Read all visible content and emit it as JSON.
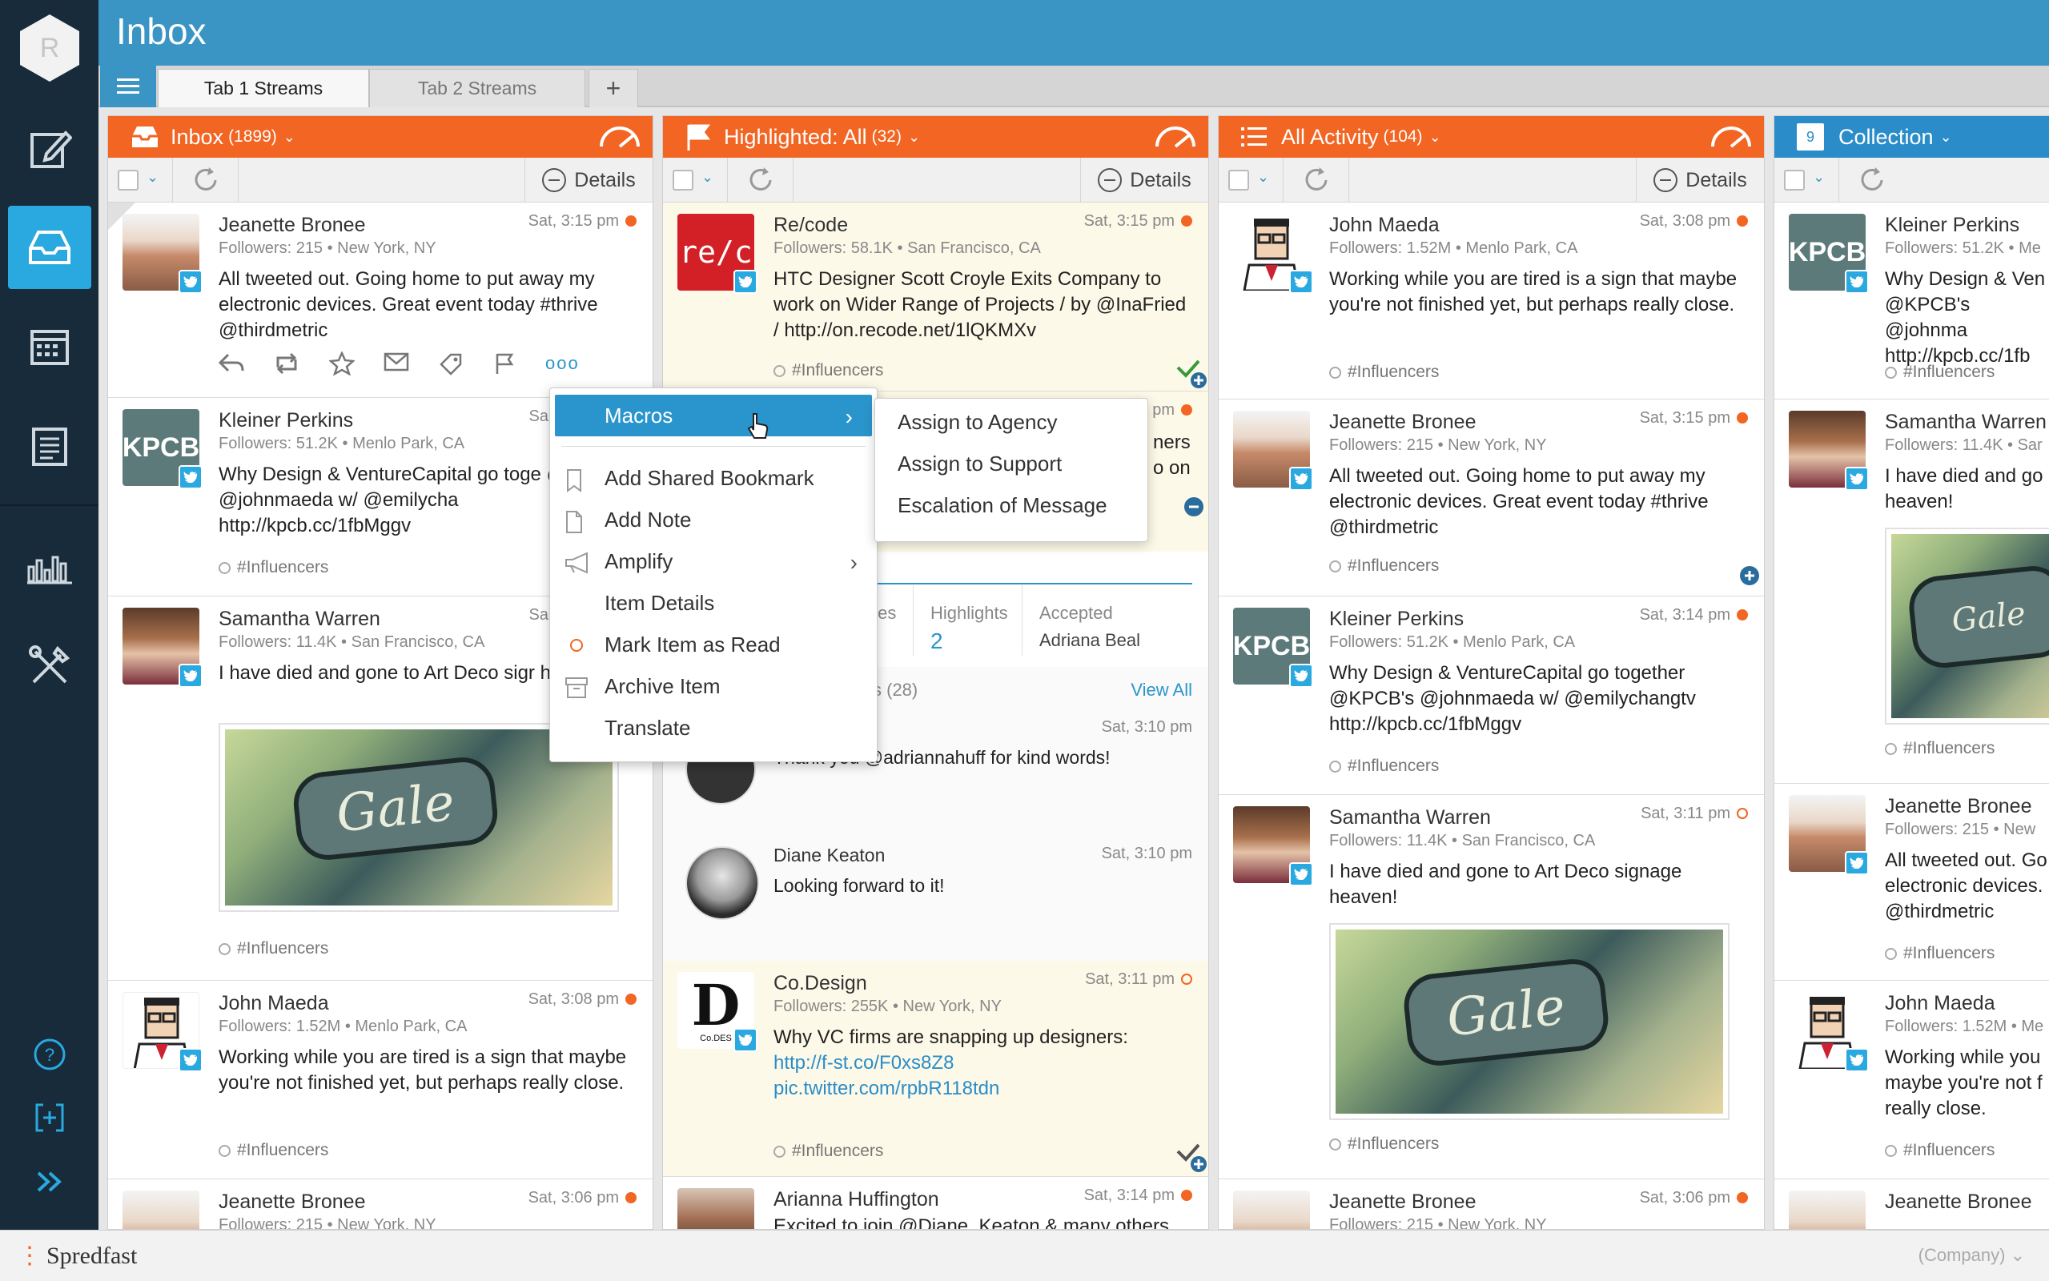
{
  "app": {
    "title": "Inbox",
    "brand_letter": "R",
    "footer_logo": "Spredfast",
    "footer_company": "(Company)"
  },
  "tabs": [
    {
      "label": "Tab 1 Streams",
      "active": true
    },
    {
      "label": "Tab 2 Streams",
      "active": false
    }
  ],
  "colors": {
    "orange": "#f26522",
    "blue": "#2a95cc",
    "nav": "#172b3a",
    "topbar": "#3a95c4"
  },
  "toolbar_details": "Details",
  "columns": [
    {
      "title": "Inbox",
      "count": "(1899)",
      "icon": "inbox-tray-icon"
    },
    {
      "title": "Highlighted: All",
      "count": "(32)",
      "icon": "flag-icon"
    },
    {
      "title": "All Activity",
      "count": "(104)",
      "icon": "list-icon"
    },
    {
      "title": "Collection",
      "count": "",
      "icon": "calendar-9-icon",
      "badge": "9"
    }
  ],
  "col1": [
    {
      "name": "Jeanette Bronee",
      "meta": "Followers: 215 • New York, NY",
      "time": "Sat, 3:15 pm",
      "text": "All tweeted out. Going home to put away my electronic devices. Great event today #thrive @thirdmetric"
    },
    {
      "name": "Kleiner Perkins",
      "meta": "Followers: 51.2K • Menlo Park, CA",
      "time": "Sa",
      "text": "Why Design & VentureCapital go toge @KPCB's @johnmaeda w/ @emilycha http://kpcb.cc/1fbMggv",
      "tag": "#Influencers"
    },
    {
      "name": "Samantha Warren",
      "meta": "Followers: 11.4K • San Francisco, CA",
      "time": "Sa",
      "text": "I have died and gone to Art Deco sigr heaven!",
      "tag": "#Influencers"
    },
    {
      "name": "John Maeda",
      "meta": "Followers: 1.52M • Menlo Park, CA",
      "time": "Sat, 3:08 pm",
      "text": "Working while you are tired is a sign that maybe you're not finished yet, but perhaps really close.",
      "tag": "#Influencers"
    },
    {
      "name": "Jeanette Bronee",
      "meta": "Followers: 215 • New York, NY",
      "time": "Sat, 3:06 pm"
    }
  ],
  "col2": {
    "top": {
      "name": "Re/code",
      "meta": "Followers: 58.1K • San Francisco, CA",
      "time": "Sat, 3:15 pm",
      "text": "HTC Designer Scott Croyle Exits Company to work on Wider Range of Projects / by @InaFried / http://on.recode.net/1lQKMXv",
      "tag": "#Influencers",
      "logo": "re/c"
    },
    "partial": {
      "time": "pm",
      "line1": "ners",
      "line2": "o on"
    },
    "stats": {
      "col1": "tes",
      "highlights_label": "Highlights",
      "highlights_value": "2",
      "accepted_label": "Accepted",
      "accepted_value": "Adriana Beal"
    },
    "replies_label": "s (28)",
    "view_all": "View All",
    "reply1": {
      "time": "Sat, 3:10 pm",
      "text": "Thank you @adriannahuff for kind words!"
    },
    "reply2": {
      "name": "Diane Keaton",
      "time": "Sat, 3:10 pm",
      "text": "Looking forward to it!"
    },
    "codesign": {
      "name": "Co.Design",
      "meta": "Followers: 255K • New York, NY",
      "time": "Sat, 3:11 pm",
      "text": "Why VC firms are snapping up designers:",
      "link1": "http://f-st.co/F0xs8Z8",
      "link2": "pic.twitter.com/rpbR118tdn",
      "tag": "#Influencers",
      "logo": "D",
      "logo_sub": "Co.DES"
    },
    "arianna": {
      "name": "Arianna Huffington",
      "time": "Sat, 3:14 pm",
      "text": "Excited to join @Diane_Keaton & many others"
    }
  },
  "col3": [
    {
      "name": "John Maeda",
      "meta": "Followers: 1.52M • Menlo Park, CA",
      "time": "Sat, 3:08 pm",
      "text": "Working while you are tired is a sign that maybe you're not finished yet, but perhaps really close.",
      "tag": "#Influencers"
    },
    {
      "name": "Jeanette Bronee",
      "meta": "Followers: 215 • New York, NY",
      "time": "Sat, 3:15 pm",
      "text": "All tweeted out. Going home to put away my electronic devices. Great event today #thrive @thirdmetric",
      "tag": "#Influencers"
    },
    {
      "name": "Kleiner Perkins",
      "meta": "Followers: 51.2K • Menlo Park, CA",
      "time": "Sat, 3:14 pm",
      "text": "Why Design & VentureCapital go together @KPCB's @johnmaeda w/ @emilychangtv http://kpcb.cc/1fbMggv",
      "tag": "#Influencers"
    },
    {
      "name": "Samantha Warren",
      "meta": "Followers: 11.4K • San Francisco, CA",
      "time": "Sat, 3:11 pm",
      "text": "I have died and gone to Art Deco signage heaven!",
      "tag": "#Influencers"
    },
    {
      "name": "Jeanette Bronee",
      "meta": "Followers: 215 • New York, NY",
      "time": "Sat, 3:06 pm"
    }
  ],
  "col4": [
    {
      "name": "Kleiner Perkins",
      "meta": "Followers: 51.2K • Me",
      "text": "Why Design & Ven @KPCB's @johnma http://kpcb.cc/1fb",
      "tag": "#Influencers"
    },
    {
      "name": "Samantha Warren",
      "meta": "Followers: 11.4K • Sar",
      "text": "I have died and go heaven!",
      "tag": "#Influencers"
    },
    {
      "name": "Jeanette Bronee",
      "meta": "Followers: 215 • New",
      "text": "All tweeted out. Go electronic devices. @thirdmetric",
      "tag": "#Influencers"
    },
    {
      "name": "John Maeda",
      "meta": "Followers: 1.52M • Me",
      "text": "Working while you maybe you're not f really close.",
      "tag": "#Influencers"
    },
    {
      "name": "Jeanette Bronee"
    }
  ],
  "sign_text": "Gale",
  "kpcb_logo": "KPCB",
  "context_menu": {
    "items": [
      "Macros",
      "Add Shared Bookmark",
      "Add Note",
      "Amplify",
      "Item Details",
      "Mark Item as Read",
      "Archive Item",
      "Translate"
    ]
  },
  "macros_submenu": [
    "Assign to Agency",
    "Assign to Support",
    "Escalation of Message"
  ],
  "more_dots": "ooo"
}
